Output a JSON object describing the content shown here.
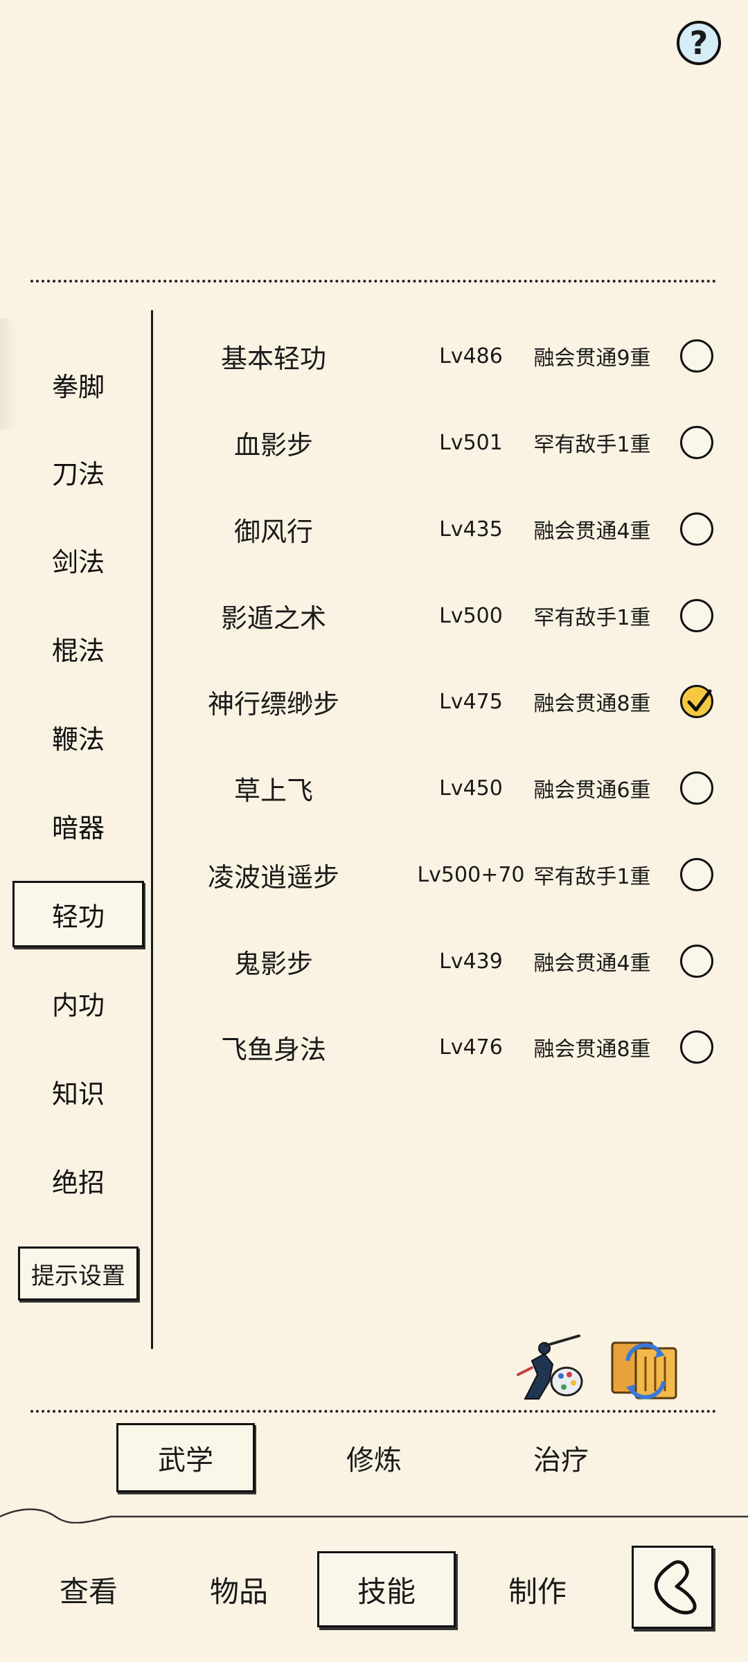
{
  "header": {
    "help_label": "?"
  },
  "categories": [
    {
      "label": "拳脚"
    },
    {
      "label": "刀法"
    },
    {
      "label": "剑法"
    },
    {
      "label": "棍法"
    },
    {
      "label": "鞭法"
    },
    {
      "label": "暗器"
    },
    {
      "label": "轻功"
    },
    {
      "label": "内功"
    },
    {
      "label": "知识"
    },
    {
      "label": "绝招"
    }
  ],
  "active_category": "轻功",
  "hint_settings_label": "提示设置",
  "skills": [
    {
      "name": "基本轻功",
      "level": "Lv486",
      "rank": "融会贯通9重",
      "selected": false
    },
    {
      "name": "血影步",
      "level": "Lv501",
      "rank": "罕有敌手1重",
      "selected": false
    },
    {
      "name": "御风行",
      "level": "Lv435",
      "rank": "融会贯通4重",
      "selected": false
    },
    {
      "name": "影遁之术",
      "level": "Lv500",
      "rank": "罕有敌手1重",
      "selected": false
    },
    {
      "name": "神行缥缈步",
      "level": "Lv475",
      "rank": "融会贯通8重",
      "selected": true
    },
    {
      "name": "草上飞",
      "level": "Lv450",
      "rank": "融会贯通6重",
      "selected": false
    },
    {
      "name": "凌波逍遥步",
      "level": "Lv500+70",
      "rank": "罕有敌手1重",
      "selected": false
    },
    {
      "name": "鬼影步",
      "level": "Lv439",
      "rank": "融会贯通4重",
      "selected": false
    },
    {
      "name": "飞鱼身法",
      "level": "Lv476",
      "rank": "融会贯通8重",
      "selected": false
    }
  ],
  "action_icons": {
    "left": "martial-artist-palette-icon",
    "right": "scroll-swap-icon"
  },
  "sub_tabs": [
    {
      "label": "武学",
      "active": true
    },
    {
      "label": "修炼",
      "active": false
    },
    {
      "label": "治疗",
      "active": false
    }
  ],
  "bottom_nav": [
    {
      "label": "查看",
      "active": false
    },
    {
      "label": "物品",
      "active": false
    },
    {
      "label": "技能",
      "active": true
    },
    {
      "label": "制作",
      "active": false
    }
  ],
  "back_icon": "back-arrow-icon",
  "colors": {
    "background": "#faf3e3",
    "check_fill": "#f5c842",
    "ink": "#111111"
  }
}
